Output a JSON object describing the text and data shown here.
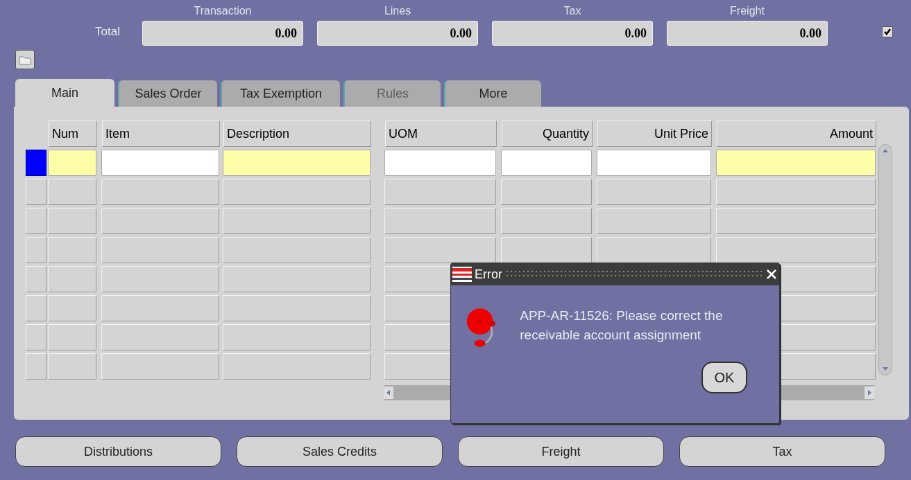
{
  "totals": {
    "label": "Total",
    "fields": [
      {
        "heading": "Transaction",
        "value": "0.00"
      },
      {
        "heading": "Lines",
        "value": "0.00"
      },
      {
        "heading": "Tax",
        "value": "0.00"
      },
      {
        "heading": "Freight",
        "value": "0.00"
      }
    ],
    "checked": true
  },
  "tabs": [
    {
      "label": "Main",
      "selected": true,
      "disabled": false
    },
    {
      "label": "Sales Order",
      "selected": false,
      "disabled": false
    },
    {
      "label": "Tax Exemption",
      "selected": false,
      "disabled": false
    },
    {
      "label": "Rules",
      "selected": false,
      "disabled": true
    },
    {
      "label": "More",
      "selected": false,
      "disabled": false
    }
  ],
  "table": {
    "columns": [
      {
        "name": "Num",
        "required": true,
        "kind": "text"
      },
      {
        "name": "Item",
        "required": false,
        "kind": "text"
      },
      {
        "name": "Description",
        "required": true,
        "kind": "text"
      },
      {
        "name": "UOM",
        "required": false,
        "kind": "text"
      },
      {
        "name": "Quantity",
        "required": false,
        "kind": "number"
      },
      {
        "name": "Unit Price",
        "required": false,
        "kind": "number"
      },
      {
        "name": "Amount",
        "required": true,
        "kind": "number"
      }
    ],
    "rows": [
      {
        "selected": true
      },
      {
        "selected": false
      },
      {
        "selected": false
      },
      {
        "selected": false
      },
      {
        "selected": false
      },
      {
        "selected": false
      },
      {
        "selected": false
      },
      {
        "selected": false
      }
    ]
  },
  "dialog": {
    "title": "Error",
    "message": "APP-AR-11526: Please correct the receivable account assignment",
    "button": "OK"
  },
  "buttons": [
    "Distributions",
    "Sales Credits",
    "Freight",
    "Tax"
  ]
}
